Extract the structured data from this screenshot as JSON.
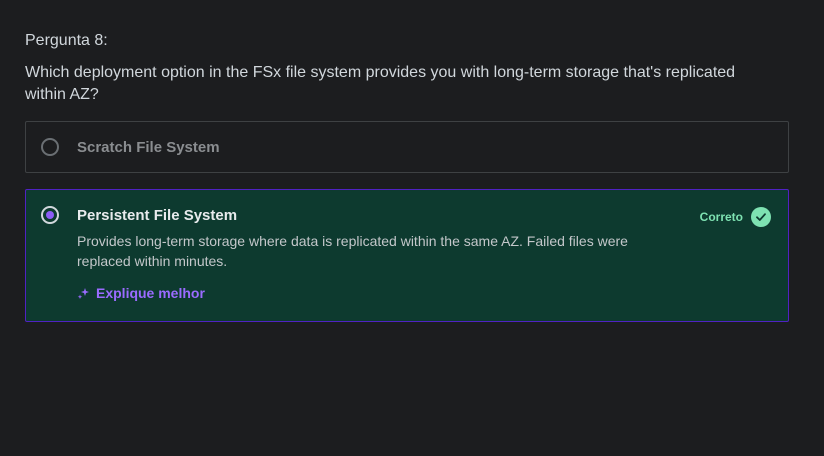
{
  "question": {
    "number_label": "Pergunta 8:",
    "text": "Which deployment option in the FSx file system provides you with long-term storage that's replicated within AZ?"
  },
  "options": [
    {
      "title": "Scratch File System",
      "selected": false
    },
    {
      "title": "Persistent File System",
      "selected": true,
      "description": "Provides long-term storage where data is replicated within the same AZ. Failed files were replaced within minutes.",
      "status_label": "Correto",
      "explain_label": "Explique melhor"
    }
  ],
  "colors": {
    "background": "#1c1d1f",
    "correct_bg": "#0d3a2f",
    "accent_purple": "#8c5cf5",
    "correct_green": "#7ee2b2"
  },
  "icons": {
    "status": "check-circle-icon",
    "explain": "sparkle-icon"
  }
}
